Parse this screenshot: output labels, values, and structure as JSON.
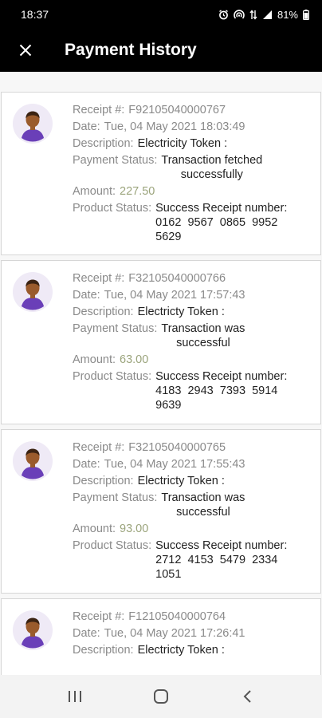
{
  "status_bar": {
    "time": "18:37",
    "battery": "81%",
    "icons": [
      "alarm-icon",
      "hotspot-icon",
      "data-arrows-icon",
      "signal-icon",
      "battery-icon"
    ]
  },
  "header": {
    "close_icon": "close-icon",
    "title": "Payment History"
  },
  "colors": {
    "header_bg": "#000000",
    "amount": "#9ba47c",
    "label": "#8a8a8a",
    "avatar_shirt": "#6a3fb8",
    "avatar_skin": "#9a5b2c",
    "avatar_bg": "#efeaf6"
  },
  "labels": {
    "receipt": "Receipt #:",
    "date": "Date:",
    "description": "Description:",
    "payment_status": "Payment Status:",
    "amount": "Amount:",
    "product_status": "Product Status:"
  },
  "payments": [
    {
      "receipt": "F92105040000767",
      "date": "Tue, 04 May 2021 18:03:49",
      "description": "Electricity Token :",
      "payment_status": [
        "Transaction fetched",
        "successfully"
      ],
      "amount": "227.50",
      "product_status": [
        "Success Receipt number:",
        "0162  9567  0865  9952",
        "5629"
      ]
    },
    {
      "receipt": "F32105040000766",
      "date": "Tue, 04 May 2021 17:57:43",
      "description": "Electricty Token :",
      "payment_status": [
        "Transaction was",
        "successful"
      ],
      "amount": "63.00",
      "product_status": [
        "Success Receipt number:",
        "4183  2943  7393  5914",
        "9639"
      ]
    },
    {
      "receipt": "F32105040000765",
      "date": "Tue, 04 May 2021 17:55:43",
      "description": "Electricty Token :",
      "payment_status": [
        "Transaction was",
        "successful"
      ],
      "amount": "93.00",
      "product_status": [
        "Success Receipt number:",
        "2712  4153  5479  2334",
        "1051"
      ]
    },
    {
      "receipt": "F12105040000764",
      "date": "Tue, 04 May 2021 17:26:41",
      "description": "Electricty Token :"
    }
  ],
  "nav": {
    "recents": "recents-icon",
    "home": "home-icon",
    "back": "back-icon"
  }
}
